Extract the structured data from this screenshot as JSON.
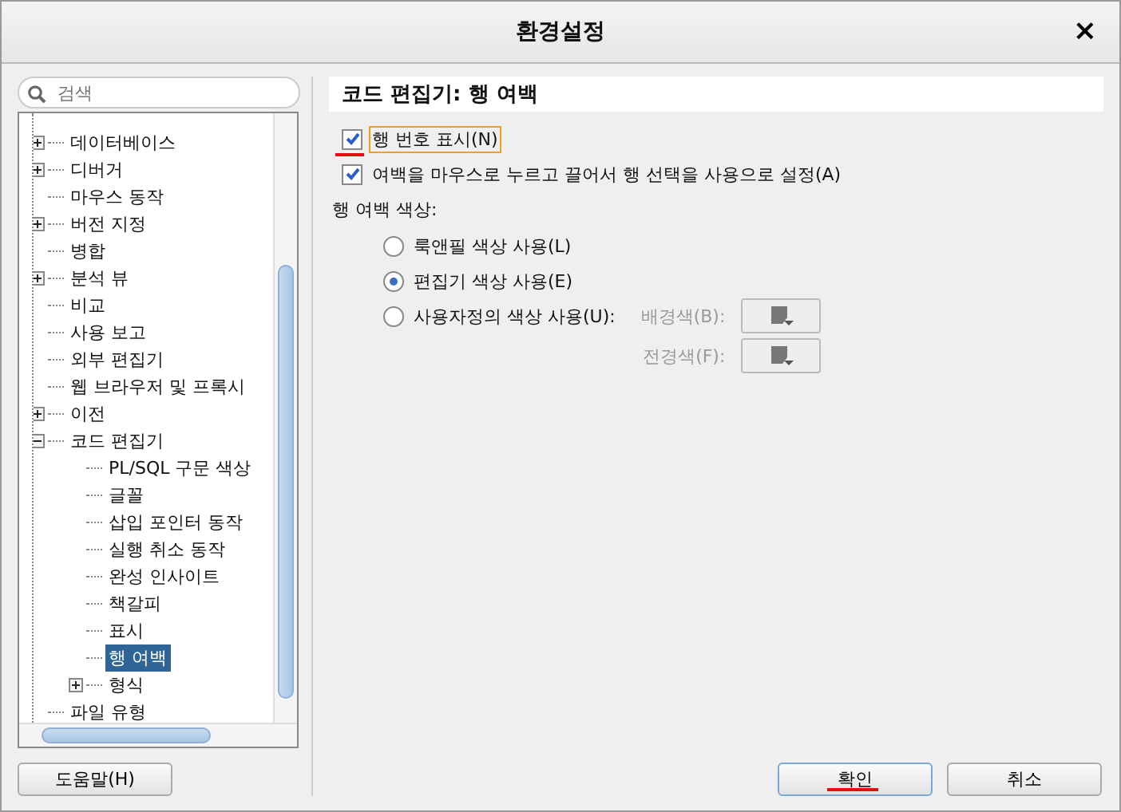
{
  "window": {
    "title": "환경설정",
    "close": "×"
  },
  "search": {
    "placeholder": "검색"
  },
  "tree": [
    {
      "label": "데이터베이스",
      "expanded": false,
      "selected": false
    },
    {
      "label": "디버거",
      "expanded": false,
      "selected": false
    },
    {
      "label": "마우스 동작",
      "selected": false
    },
    {
      "label": "버전 지정",
      "expanded": false,
      "selected": false
    },
    {
      "label": "병합",
      "selected": false
    },
    {
      "label": "분석 뷰",
      "expanded": false,
      "selected": false
    },
    {
      "label": "비교",
      "selected": false
    },
    {
      "label": "사용 보고",
      "selected": false
    },
    {
      "label": "외부 편집기",
      "selected": false
    },
    {
      "label": "웹 브라우저 및 프록시",
      "selected": false
    },
    {
      "label": "이전",
      "expanded": false,
      "selected": false
    },
    {
      "label": "코드 편집기",
      "expanded": true,
      "selected": false,
      "children": [
        {
          "label": "PL/SQL 구문 색상",
          "selected": false
        },
        {
          "label": "글꼴",
          "selected": false
        },
        {
          "label": "삽입 포인터 동작",
          "selected": false
        },
        {
          "label": "실행 취소 동작",
          "selected": false
        },
        {
          "label": "완성 인사이트",
          "selected": false
        },
        {
          "label": "책갈피",
          "selected": false
        },
        {
          "label": "표시",
          "selected": false
        },
        {
          "label": "행 여백",
          "selected": true
        },
        {
          "label": "형식",
          "expanded": false,
          "selected": false
        }
      ]
    },
    {
      "label": "파일 유형",
      "selected": false
    }
  ],
  "panel": {
    "title": "코드 편집기: 행 여백",
    "checkboxes": [
      {
        "label": "행 번호 표시(N)",
        "checked": true,
        "focused": true
      },
      {
        "label": "여백을 마우스로 누르고 끌어서 행 선택을 사용으로 설정(A)",
        "checked": true,
        "focused": false
      }
    ],
    "color_group_label": "행 여백 색상:",
    "radios": [
      {
        "label": "룩앤필 색상 사용(L)",
        "selected": false
      },
      {
        "label": "편집기 색상 사용(E)",
        "selected": true
      },
      {
        "label": "사용자정의 색상 사용(U):",
        "selected": false
      }
    ],
    "color_pickers": [
      {
        "label": "배경색(B):",
        "disabled": true
      },
      {
        "label": "전경색(F):",
        "disabled": true
      }
    ]
  },
  "buttons": {
    "help": "도움말(H)",
    "ok": "확인",
    "cancel": "취소"
  }
}
